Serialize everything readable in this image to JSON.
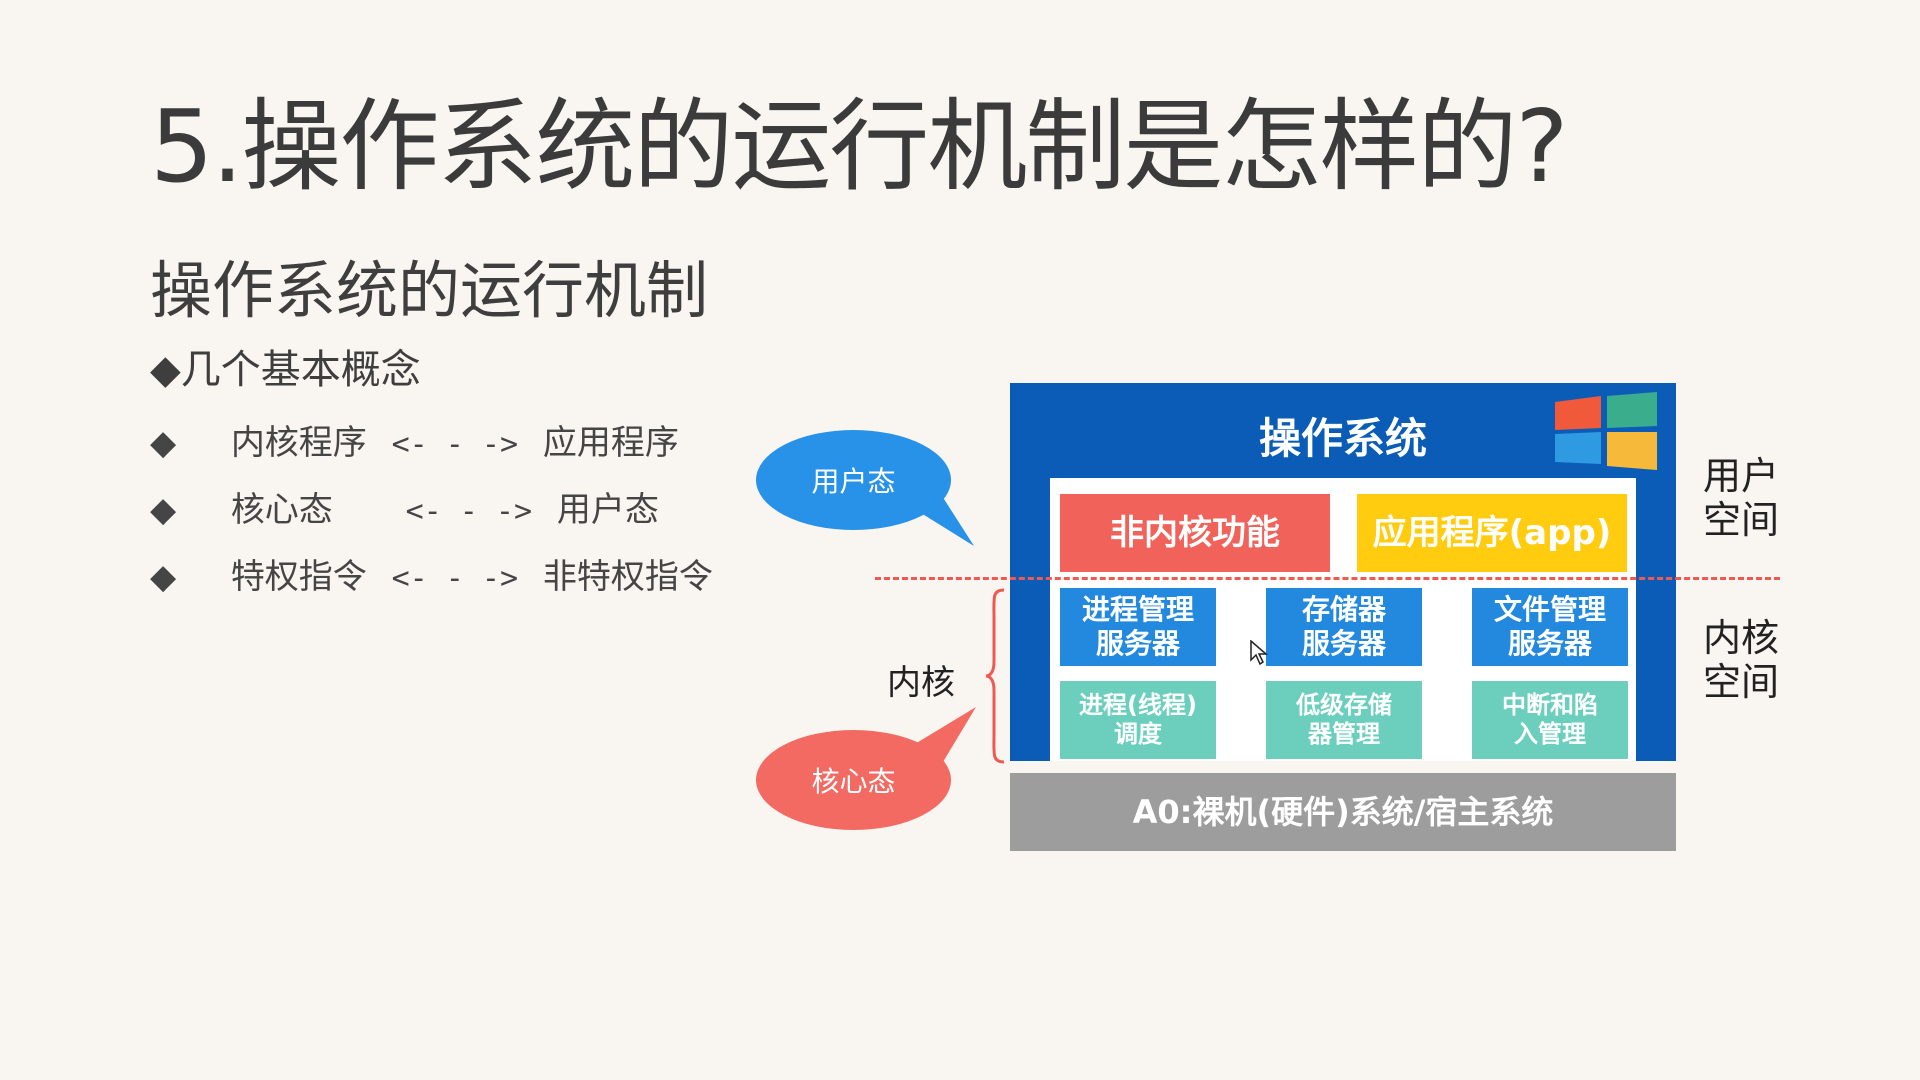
{
  "slide": {
    "title": "5.操作系统的运行机制是怎样的?",
    "subtitle": "操作系统的运行机制",
    "concepts_heading": "◆几个基本概念",
    "bullets": [
      {
        "marker": "◆",
        "left": "内核程序",
        "arrow": "<- - ->",
        "right": "应用程序"
      },
      {
        "marker": "◆",
        "left": "核心态",
        "arrow": "<- - ->",
        "right": "用户态"
      },
      {
        "marker": "◆",
        "left": "特权指令",
        "arrow": "<- - ->",
        "right": "非特权指令"
      }
    ]
  },
  "diagram": {
    "os_title": "操作系统",
    "user_layer": {
      "non_kernel": "非内核功能",
      "app": "应用程序(app)"
    },
    "kernel_services": [
      {
        "line1": "进程管理",
        "line2": "服务器"
      },
      {
        "line1": "存储器",
        "line2": "服务器"
      },
      {
        "line1": "文件管理",
        "line2": "服务器"
      }
    ],
    "kernel_low": [
      {
        "line1": "进程(线程)",
        "line2": "调度"
      },
      {
        "line1": "低级存储",
        "line2": "器管理"
      },
      {
        "line1": "中断和陷",
        "line2": "入管理"
      }
    ],
    "hardware": "A0:裸机(硬件)系统/宿主系统",
    "user_space_label": {
      "line1": "用户",
      "line2": "空间"
    },
    "kernel_space_label": {
      "line1": "内核",
      "line2": "空间"
    },
    "kernel_label": "内核",
    "bubble_user": "用户态",
    "bubble_kernel": "核心态",
    "colors": {
      "os_blue": "#0b5cb7",
      "red": "#f1625a",
      "yellow": "#ffcc0f",
      "service_blue": "#2389df",
      "teal": "#6ccfbd",
      "hardware_gray": "#9d9d9d",
      "dashed_line": "#ee5a52"
    },
    "logo_icon": "windows-logo-icon"
  }
}
